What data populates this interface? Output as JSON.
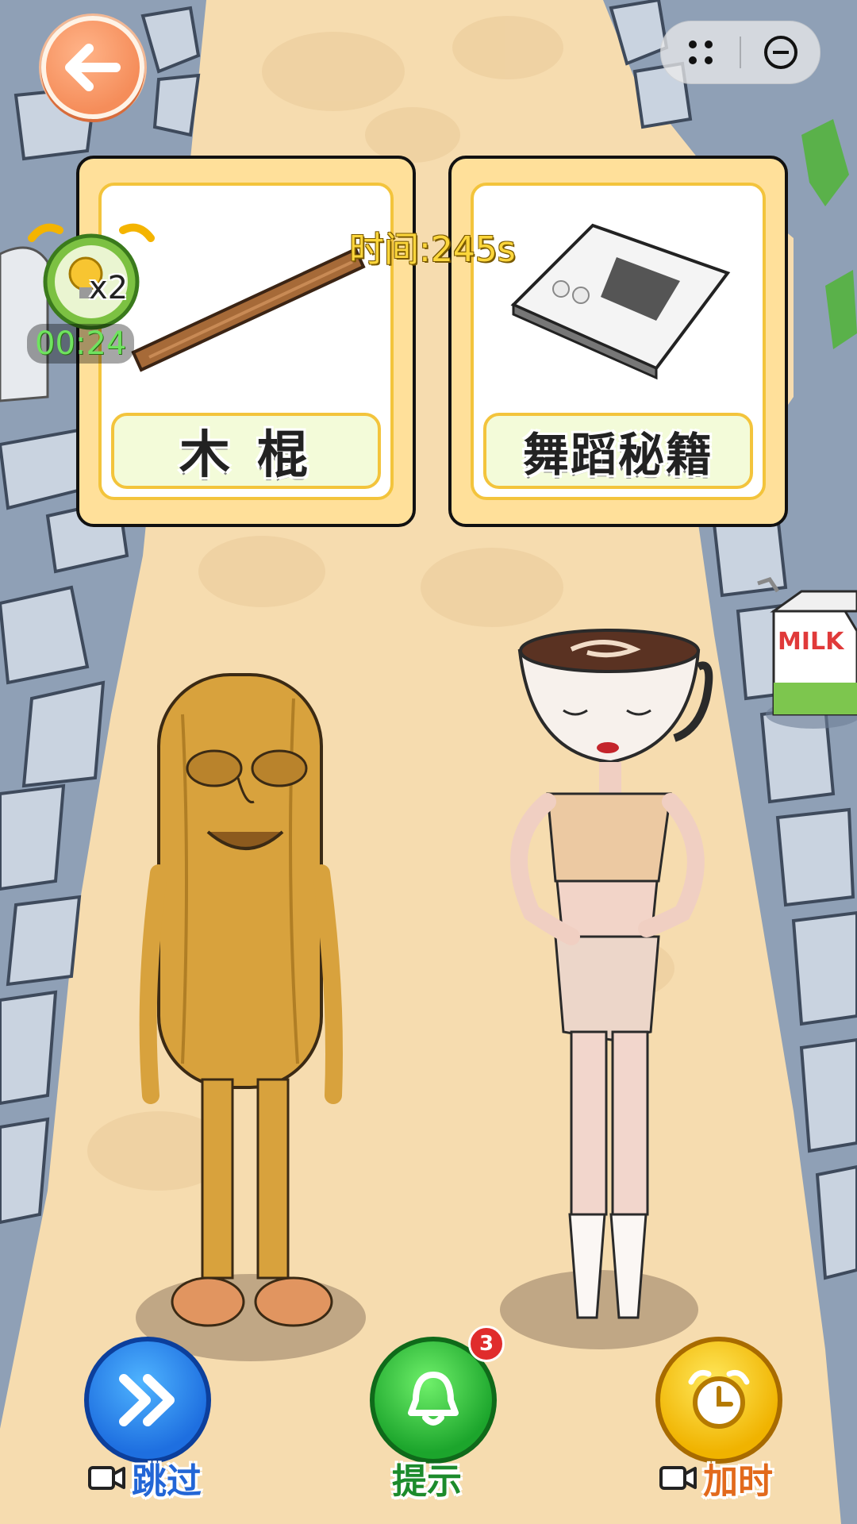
{
  "top_bar": {
    "back_icon": "arrow-left-icon",
    "capsule_icons": [
      "more-dots-icon",
      "close-circle-icon"
    ]
  },
  "cards": [
    {
      "label": "木 棍",
      "item_icon": "wooden-stick-icon"
    },
    {
      "label": "舞蹈秘籍",
      "item_icon": "dance-book-icon"
    }
  ],
  "timer": {
    "text": "时间:245s"
  },
  "hint_clock": {
    "count": "x2",
    "time": "00:24",
    "icon": "lightbulb-alarm-clock-icon"
  },
  "characters": [
    {
      "name": "wooden-stick-man"
    },
    {
      "name": "coffee-cup-ballerina"
    }
  ],
  "side_item": {
    "icon": "milk-carton-icon"
  },
  "bottom_buttons": {
    "skip": {
      "label": "跳过",
      "icon": "double-chevron-right-icon"
    },
    "hint": {
      "label": "提示",
      "icon": "bell-icon",
      "badge": "3"
    },
    "add_time": {
      "label": "加时",
      "icon": "alarm-clock-icon"
    }
  },
  "colors": {
    "path": "#f6dcaf",
    "card_bg": "#ffe09a",
    "card_border": "#f3c43c",
    "timer_text": "#fcd63b",
    "skip_blue": "#1e6fe0",
    "hint_green": "#1ca52c",
    "time_yellow": "#f0b300"
  }
}
